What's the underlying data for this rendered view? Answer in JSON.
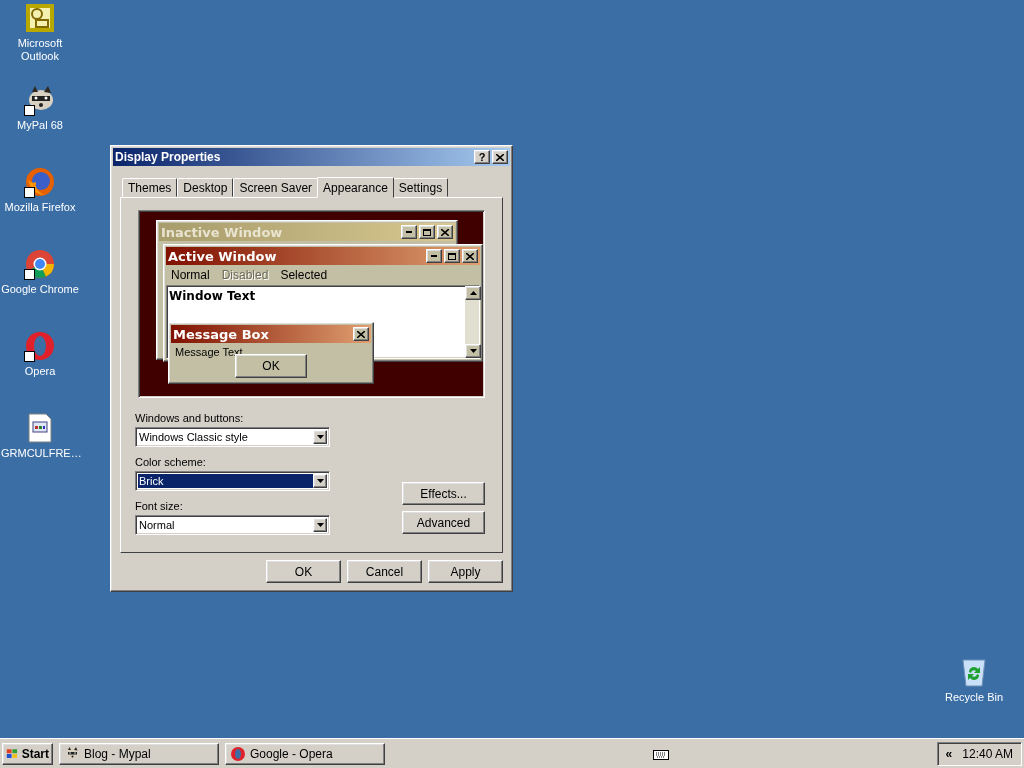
{
  "desktop_icons": [
    {
      "label": "Microsoft Outlook",
      "kind": "outlook"
    },
    {
      "label": "MyPal 68",
      "kind": "mypal"
    },
    {
      "label": "Mozilla Firefox",
      "kind": "firefox"
    },
    {
      "label": "Google Chrome",
      "kind": "chrome"
    },
    {
      "label": "Opera",
      "kind": "opera"
    },
    {
      "label": "GRMCULFRE…",
      "kind": "file"
    }
  ],
  "recycle_bin": {
    "label": "Recycle Bin"
  },
  "dialog": {
    "title": "Display Properties",
    "help": "?",
    "tabs": [
      {
        "label": "Themes",
        "selected": false
      },
      {
        "label": "Desktop",
        "selected": false
      },
      {
        "label": "Screen Saver",
        "selected": false
      },
      {
        "label": "Appearance",
        "selected": true
      },
      {
        "label": "Settings",
        "selected": false
      }
    ],
    "preview": {
      "inactive_title": "Inactive Window",
      "active_title": "Active Window",
      "menu": [
        {
          "label": "Normal",
          "disabled": false
        },
        {
          "label": "Disabled",
          "disabled": true
        },
        {
          "label": "Selected",
          "disabled": false
        }
      ],
      "window_text": "Window Text",
      "message_title": "Message Box",
      "message_text": "Message Text",
      "ok": "OK"
    },
    "fields": [
      {
        "label": "Windows and buttons:",
        "value": "Windows Classic style",
        "focused": false
      },
      {
        "label": "Color scheme:",
        "value": "Brick",
        "focused": true
      },
      {
        "label": "Font size:",
        "value": "Normal",
        "focused": false
      }
    ],
    "side_buttons": [
      "Effects...",
      "Advanced"
    ],
    "buttons": [
      "OK",
      "Cancel",
      "Apply"
    ]
  },
  "taskbar": {
    "start": "Start",
    "tasks": [
      {
        "label": "Blog - Mypal",
        "kind": "mypal"
      },
      {
        "label": "Google - Opera",
        "kind": "opera"
      }
    ],
    "chevron": "«",
    "clock": "12:40 AM"
  }
}
